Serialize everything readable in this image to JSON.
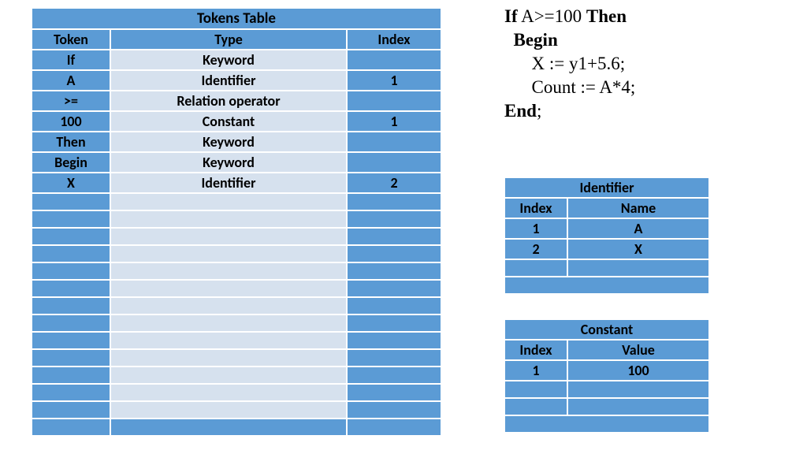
{
  "chart_data": {
    "type": "table",
    "tokens_table": {
      "title": "Tokens Table",
      "columns": [
        "Token",
        "Type",
        "Index"
      ],
      "rows": [
        {
          "token": "If",
          "type": "Keyword",
          "index": ""
        },
        {
          "token": "A",
          "type": "Identifier",
          "index": "1"
        },
        {
          "token": ">=",
          "type": "Relation operator",
          "index": ""
        },
        {
          "token": "100",
          "type": "Constant",
          "index": "1"
        },
        {
          "token": "Then",
          "type": "Keyword",
          "index": ""
        },
        {
          "token": "Begin",
          "type": "Keyword",
          "index": ""
        },
        {
          "token": "X",
          "type": "Identifier",
          "index": "2"
        }
      ],
      "blank_rows": 13
    },
    "identifier_table": {
      "title": "Identifier",
      "columns": [
        "Index",
        "Name"
      ],
      "rows": [
        {
          "index": "1",
          "name": "A"
        },
        {
          "index": "2",
          "name": "X"
        }
      ],
      "blank_rows": 1
    },
    "constant_table": {
      "title": "Constant",
      "columns": [
        "Index",
        "Value"
      ],
      "rows": [
        {
          "index": "1",
          "value": "100"
        }
      ],
      "blank_rows": 2
    }
  },
  "code": {
    "line1_kw1": "If",
    "line1_expr": " A>=100 ",
    "line1_kw2": "Then",
    "line2": "  Begin",
    "line3": "      X := y1+5.6;",
    "line4": "      Count := A*4;",
    "line5": "End",
    "line5_tail": ";"
  }
}
